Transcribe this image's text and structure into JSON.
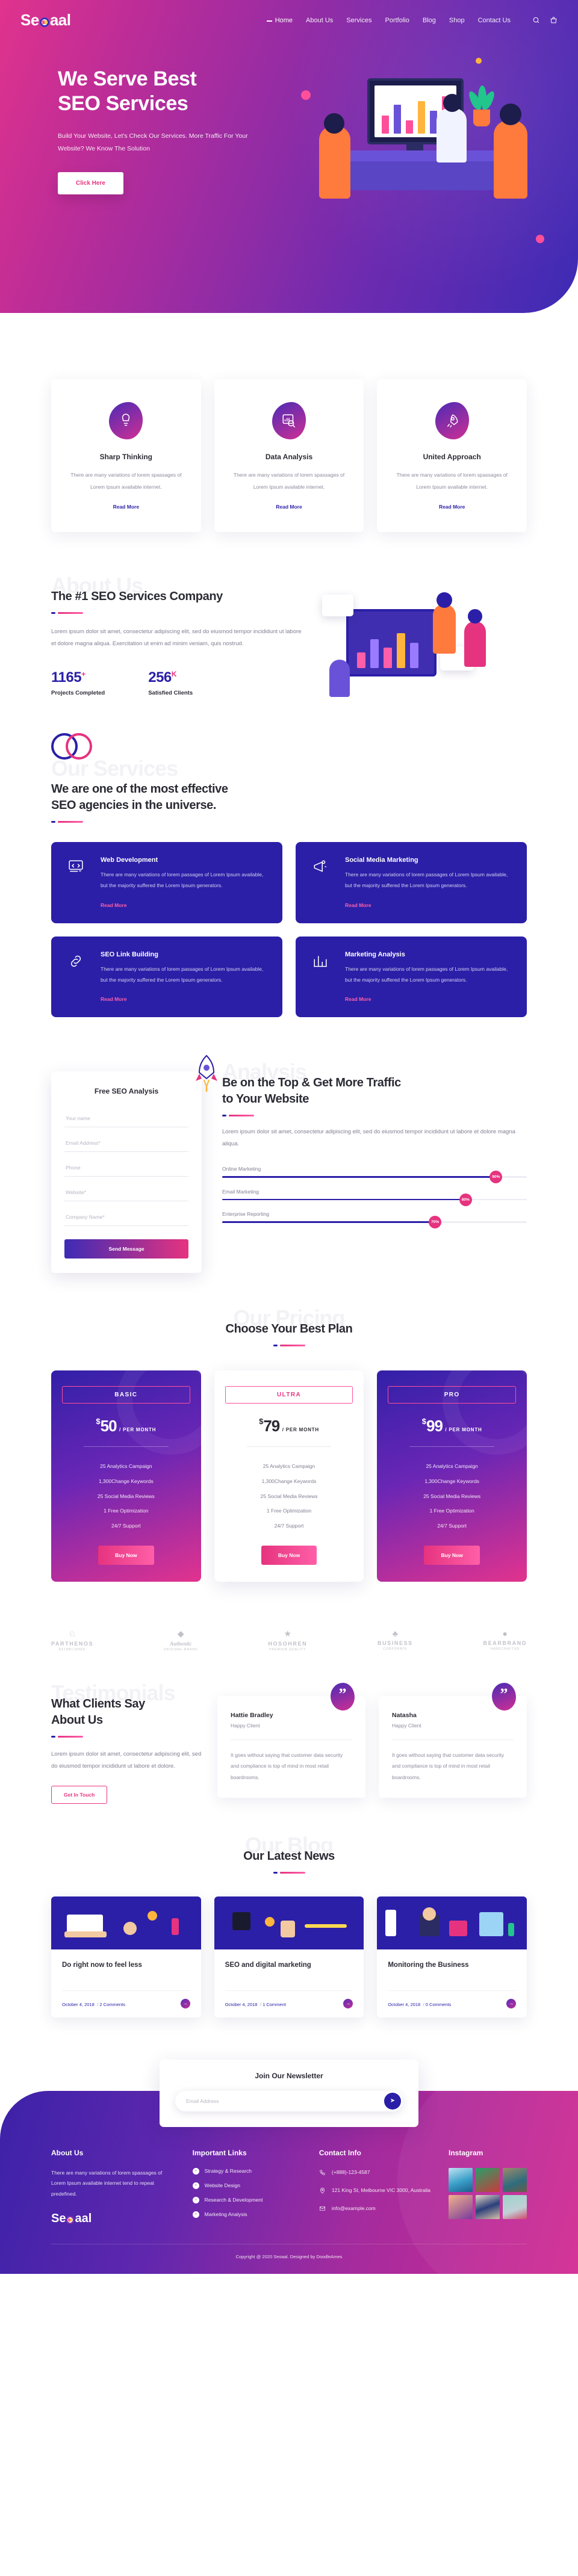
{
  "brand": {
    "name": "Seoaal"
  },
  "nav": {
    "items": [
      {
        "label": "Home",
        "active": true
      },
      {
        "label": "About Us",
        "active": false
      },
      {
        "label": "Services",
        "active": false
      },
      {
        "label": "Portfolio",
        "active": false
      },
      {
        "label": "Blog",
        "active": false
      },
      {
        "label": "Shop",
        "active": false
      },
      {
        "label": "Contact Us",
        "active": false
      }
    ],
    "icons": [
      "search-icon",
      "bag-icon"
    ]
  },
  "hero": {
    "title_line1": "We Serve Best",
    "title_line2": "SEO Services",
    "subtitle": "Build Your Website, Let's Check Our Services. More Traffic For Your Website? We Know The Solution",
    "cta": "Click Here"
  },
  "features": [
    {
      "icon": "brain-idea-icon",
      "title": "Sharp Thinking",
      "text": "There are many variations of lorem spassages of Lorem Ipsum available internet.",
      "link": "Read More"
    },
    {
      "icon": "chart-search-icon",
      "title": "Data Analysis",
      "text": "There are many variations of lorem spassages of Lorem Ipsum available internet.",
      "link": "Read More"
    },
    {
      "icon": "rocket-icon",
      "title": "United Approach",
      "text": "There are many variations of lorem spassages of Lorem Ipsum available internet.",
      "link": "Read More"
    }
  ],
  "about": {
    "watermark": "About Us",
    "title": "The #1 SEO Services Company",
    "text": "Lorem ipsum dolor sit amet, consectetur adipiscing elit, sed do eiusmod tempor incididunt ut labore et dolore magna aliqua. Exercitation ut enim ad minim veniam, quis nostrud.",
    "stats": [
      {
        "number": "1165",
        "sup": "+",
        "label": "Projects Completed"
      },
      {
        "number": "256",
        "sup": "K",
        "label": "Satisfied Clients"
      }
    ]
  },
  "services": {
    "watermark": "Our Services",
    "title_line1": "We are one of the most effective",
    "title_line2": "SEO agencies in the universe.",
    "cards": [
      {
        "icon": "code-monitor-icon",
        "title": "Web Development",
        "text": "There are many variations of lorem passages of Lorem Ipsum available, but the majority suffered the Lorem Ipsum generators.",
        "link": "Read More"
      },
      {
        "icon": "megaphone-icon",
        "title": "Social Media Marketing",
        "text": "There are many variations of lorem passages of Lorem Ipsum available, but the majority suffered the Lorem Ipsum generators.",
        "link": "Read More"
      },
      {
        "icon": "link-chain-icon",
        "title": "SEO Link Building",
        "text": "There are many variations of lorem passages of Lorem Ipsum available, but the majority suffered the Lorem Ipsum generators.",
        "link": "Read More"
      },
      {
        "icon": "graph-bars-icon",
        "title": "Marketing Analysis",
        "text": "There are many variations of lorem passages of Lorem Ipsum available, but the majority suffered the Lorem Ipsum generators.",
        "link": "Read More"
      }
    ]
  },
  "analysis": {
    "form_title": "Free SEO Analysis",
    "fields": [
      {
        "placeholder": "Your name"
      },
      {
        "placeholder": "Email Address*"
      },
      {
        "placeholder": "Phone"
      },
      {
        "placeholder": "Website*"
      },
      {
        "placeholder": "Company Name*"
      }
    ],
    "submit": "Send Message",
    "watermark": "Analysis",
    "title_line1": "Be on the Top & Get More Traffic",
    "title_line2": "to Your Website",
    "text": "Lorem ipsum dolor sit amet, consectetur adipiscing elit, sed do eiusmod tempor incididunt ut labore et dolore magna aliqua.",
    "bars": [
      {
        "label": "Online Marketing",
        "value": 90,
        "value_label": "90%"
      },
      {
        "label": "Email Marketing",
        "value": 80,
        "value_label": "80%"
      },
      {
        "label": "Enterprise Reporting",
        "value": 70,
        "value_label": "70%"
      }
    ]
  },
  "pricing": {
    "watermark": "Our Pricing",
    "title": "Choose Your Best Plan",
    "plans": [
      {
        "name": "BASIC",
        "currency": "$",
        "amount": "50",
        "per": "/ PER MONTH",
        "style": "dark",
        "features": [
          "25 Analytics Campaign",
          "1,300Change Keywords",
          "25 Social Media Reviews",
          "1 Free Optimization",
          "24/7 Support"
        ],
        "cta": "Buy Now"
      },
      {
        "name": "ULTRA",
        "currency": "$",
        "amount": "79",
        "per": "/ PER MONTH",
        "style": "light",
        "features": [
          "25 Analytics Campaign",
          "1,300Change Keywords",
          "25 Social Media Reviews",
          "1 Free Optimization",
          "24/7 Support"
        ],
        "cta": "Buy Now"
      },
      {
        "name": "PRO",
        "currency": "$",
        "amount": "99",
        "per": "/ PER MONTH",
        "style": "dark",
        "features": [
          "25 Analytics Campaign",
          "1,300Change Keywords",
          "25 Social Media Reviews",
          "1 Free Optimization",
          "24/7 Support"
        ],
        "cta": "Buy Now"
      }
    ]
  },
  "brands": [
    {
      "name": "PARTHENOS",
      "sub": "ESTABLISHED"
    },
    {
      "name": "Authentic",
      "sub": "ORIGINAL BRAND"
    },
    {
      "name": "HOSOHREN",
      "sub": "PREMIUM QUALITY"
    },
    {
      "name": "BUSINESS",
      "sub": "CORPORATE"
    },
    {
      "name": "BEARBRAND",
      "sub": "HANDCRAFTED"
    }
  ],
  "testimonials": {
    "watermark": "Testimonials",
    "title_line1": "What Clients Say",
    "title_line2": "About Us",
    "text": "Lorem ipsum dolor sit amet, consectetur adipiscing elit, sed do eiusmod tempor incididunt ut labore et dolore.",
    "cta": "Get In Touch",
    "items": [
      {
        "name": "Hattie Bradley",
        "role": "Happy Client",
        "quote": "It goes without saying that customer data security and compliance is top of mind in most retail boardrooms."
      },
      {
        "name": "Natasha",
        "role": "Happy Client",
        "quote": "It goes without saying that customer data security and compliance is top of mind in most retail boardrooms."
      }
    ]
  },
  "blog": {
    "watermark": "Our Blog",
    "title": "Our Latest News",
    "posts": [
      {
        "title": "Do right now to feel less",
        "date": "October 4, 2018",
        "comments": "2 Comments"
      },
      {
        "title": "SEO and digital marketing",
        "date": "October 4, 2018",
        "comments": "1 Comment"
      },
      {
        "title": "Monitoring the Business",
        "date": "October 4, 2018",
        "comments": "0 Comments"
      }
    ]
  },
  "newsletter": {
    "title": "Join Our Newsletter",
    "placeholder": "Email Address",
    "send_icon": "send-icon"
  },
  "footer": {
    "about": {
      "title": "About Us",
      "text": "There are many variations of lorem spassages of Lorem Ipsum available internet tend to repeat predefined."
    },
    "links": {
      "title": "Important Links",
      "items": [
        "Strategy & Research",
        "Website Design",
        "Research & Development",
        "Marketing Analysis"
      ]
    },
    "contact": {
      "title": "Contact Info",
      "items": [
        {
          "icon": "phone-icon",
          "text": "(+888)-123-4587"
        },
        {
          "icon": "location-icon",
          "text": "121 King St, Melbourne VIC 3000, Australia"
        },
        {
          "icon": "mail-icon",
          "text": "info@example.com"
        }
      ]
    },
    "instagram": {
      "title": "Instagram",
      "count": 6
    },
    "copyright": "Copyright @ 2020 Seoaal. Designed by DoodleAmes"
  },
  "colors": {
    "accent_pink": "#e6337f",
    "accent_indigo": "#2b1fa8",
    "hero_gradient_start": "#e0338d",
    "hero_gradient_end": "#3d2bb5"
  }
}
